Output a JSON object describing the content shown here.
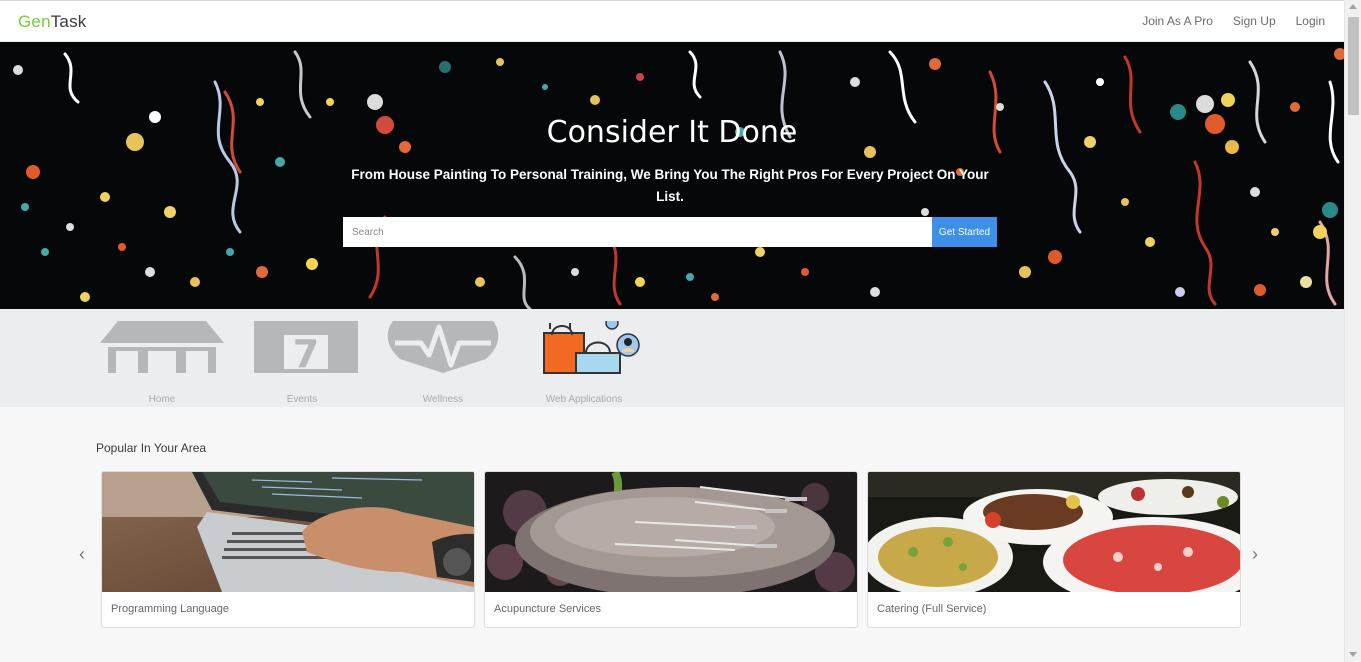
{
  "brand": {
    "part1": "Gen",
    "part2": "Task"
  },
  "nav": {
    "join_pro": "Join As A Pro",
    "sign_up": "Sign Up",
    "login": "Login"
  },
  "hero": {
    "title": "Consider It Done",
    "subtitle": "From House Painting To Personal Training, We Bring You The Right Pros For Every Project On Your List.",
    "search_placeholder": "Search",
    "cta_label": "Get Started"
  },
  "categories": [
    {
      "label": "Home",
      "icon": "house-icon"
    },
    {
      "label": "Events",
      "icon": "calendar-icon"
    },
    {
      "label": "Wellness",
      "icon": "heart-pulse-icon"
    },
    {
      "label": "Web Applications",
      "icon": "shopping-bags-icon"
    }
  ],
  "popular": {
    "title": "Popular In Your Area",
    "prev_icon": "‹",
    "next_icon": "›",
    "cards": [
      {
        "label": "Programming Language",
        "image": "laptop-typing-photo"
      },
      {
        "label": "Acupuncture Services",
        "image": "acupuncture-needles-photo"
      },
      {
        "label": "Catering (Full Service)",
        "image": "catering-food-photo"
      }
    ]
  },
  "colors": {
    "brand_green": "#7ac943",
    "cta_blue": "#3d8fe8",
    "hero_bg": "#060708"
  }
}
